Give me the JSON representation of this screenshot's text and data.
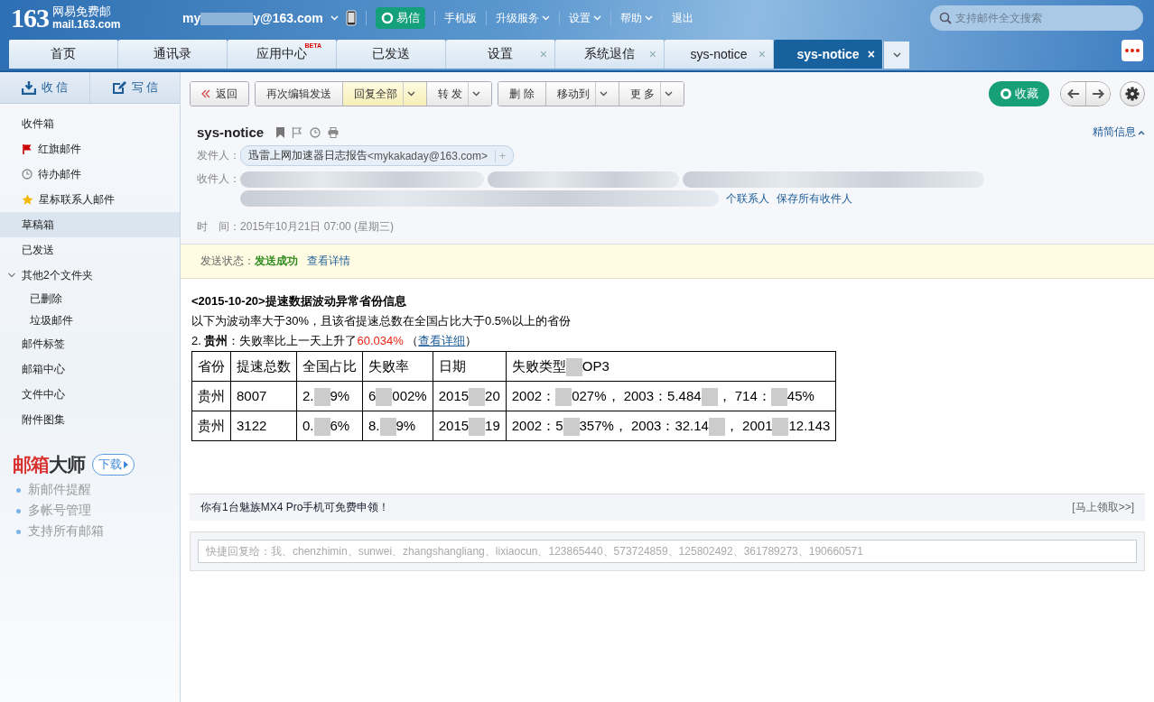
{
  "logo": {
    "number": "163",
    "name": "网易免费邮",
    "domain": "mail.163.com"
  },
  "account": {
    "parts": [
      "my",
      "y@163.com"
    ]
  },
  "yixin_button": "易信",
  "top_nav": [
    {
      "label": "手机版",
      "dropdown": false
    },
    {
      "label": "升级服务",
      "dropdown": true
    },
    {
      "label": "设置",
      "dropdown": true
    },
    {
      "label": "帮助",
      "dropdown": true
    },
    {
      "label": "退出",
      "dropdown": false
    }
  ],
  "search": {
    "placeholder": "支持邮件全文搜索"
  },
  "tabs": [
    {
      "label": "首页",
      "selected": false
    },
    {
      "label": "通讯录",
      "selected": false
    },
    {
      "label": "应用中心",
      "badge": "BETA",
      "selected": false
    },
    {
      "label": "已发送",
      "selected": false
    },
    {
      "label": "设置",
      "selected": false,
      "close": "×"
    },
    {
      "label": "系统退信",
      "selected": false,
      "close": "×"
    },
    {
      "label": "sys-notice",
      "selected": false,
      "close": "×"
    },
    {
      "label": "sys-notice",
      "selected": true,
      "close": "×"
    }
  ],
  "sidebar": {
    "receive": "收 信",
    "compose": "写 信",
    "folders": [
      {
        "label": "收件箱",
        "kind": "plain",
        "selected": false
      },
      {
        "label": "红旗邮件",
        "kind": "flagged",
        "selected": false
      },
      {
        "label": "待办邮件",
        "kind": "todo",
        "selected": false
      },
      {
        "label": "星标联系人邮件",
        "kind": "starred",
        "selected": false
      },
      {
        "label": "草稿箱",
        "kind": "plain",
        "selected": true
      },
      {
        "label": "已发送",
        "kind": "plain",
        "selected": false
      },
      {
        "label": "其他2个文件夹",
        "kind": "group",
        "selected": false,
        "expanded": true,
        "children": [
          {
            "label": "已删除",
            "selected": false
          },
          {
            "label": "垃圾邮件",
            "selected": false
          }
        ]
      },
      {
        "label": "邮件标签",
        "kind": "plain",
        "selected": false
      },
      {
        "label": "邮箱中心",
        "kind": "plain",
        "selected": false
      },
      {
        "label": "文件中心",
        "kind": "plain",
        "selected": false
      },
      {
        "label": "附件图集",
        "kind": "plain",
        "selected": false
      }
    ],
    "promo": {
      "brand_a": "邮箱",
      "brand_b": "大师",
      "download": "下载",
      "features": [
        "新邮件提醒",
        "多帐号管理",
        "支持所有邮箱"
      ]
    }
  },
  "toolbar": [
    [
      {
        "label": "返回",
        "kind": "back",
        "highlighted": false,
        "dropdown": false
      }
    ],
    [
      {
        "label": "再次编辑发送",
        "kind": "plain",
        "highlighted": false,
        "dropdown": false
      },
      {
        "label": "回复全部",
        "kind": "plain",
        "highlighted": true,
        "dropdown": true
      },
      {
        "label": "转 发",
        "kind": "plain",
        "highlighted": false,
        "dropdown": true
      }
    ],
    [
      {
        "label": "删 除",
        "kind": "plain",
        "highlighted": false,
        "dropdown": false
      },
      {
        "label": "移动到",
        "kind": "plain",
        "highlighted": false,
        "dropdown": true
      },
      {
        "label": "更 多",
        "kind": "plain",
        "highlighted": false,
        "dropdown": true
      }
    ]
  ],
  "collect_button": "收藏",
  "message": {
    "subject": "sys-notice",
    "toggle": "精简信息",
    "sender_label": "发件人：",
    "sender_name": "迅雷上网加速器日志报告",
    "sender_email": "<mykakaday@163.com>",
    "sender_add": "+",
    "recipients_label": "收件人：",
    "recipient_links": [
      "个联系人",
      "保存所有收件人"
    ],
    "time_label": "时　间：",
    "time": "2015年10月21日 07:00 (星期三)"
  },
  "send_status": {
    "label": "发送状态：",
    "value": "发送成功",
    "link": "查看详情"
  },
  "body": {
    "title": "<2015-10-20>提速数据波动异常省份信息",
    "intro": "以下为波动率大于30%，且该省提速总数在全国占比大于0.5%以上的省份",
    "item": {
      "text": "2. **贵州**：失败率比上一天上升了",
      "highlight": "60.034%",
      "open": "（",
      "link": "查看详细",
      "close": "）"
    },
    "table": {
      "columns": [
        {
          "parts": [
            "省份"
          ]
        },
        {
          "parts": [
            "提速总数"
          ]
        },
        {
          "parts": [
            "全国占比"
          ]
        },
        {
          "parts": [
            "失败率"
          ]
        },
        {
          "parts": [
            "日期"
          ]
        },
        {
          "parts": [
            "失败类型",
            "OP3"
          ]
        }
      ],
      "rows": [
        [
          {
            "parts": [
              "贵州"
            ]
          },
          {
            "parts": [
              "8007"
            ]
          },
          {
            "parts": [
              "2.",
              "9%"
            ]
          },
          {
            "parts": [
              "6",
              "002%"
            ]
          },
          {
            "parts": [
              "2015",
              "20"
            ]
          },
          {
            "parts": [
              "2002：",
              "027%， 2003：5.484",
              "， 714：",
              "45%"
            ]
          }
        ],
        [
          {
            "parts": [
              "贵州"
            ]
          },
          {
            "parts": [
              "3122"
            ]
          },
          {
            "parts": [
              "0.",
              "6%"
            ]
          },
          {
            "parts": [
              "8.",
              "9%"
            ]
          },
          {
            "parts": [
              "2015",
              "19"
            ]
          },
          {
            "parts": [
              "2002：5",
              "357%， 2003：32.14",
              "， 2001",
              "12.143"
            ]
          }
        ]
      ]
    }
  },
  "ad": {
    "text": "你有1台魅族MX4 Pro手机可免费申领！",
    "link": "[马上领取>>]"
  },
  "quick_reply": {
    "placeholder": "快捷回复给：我、chenzhimin、sunwei、zhangshangliang、lixiaocun、123865440、573724859、125802492、361789273、190660571"
  }
}
